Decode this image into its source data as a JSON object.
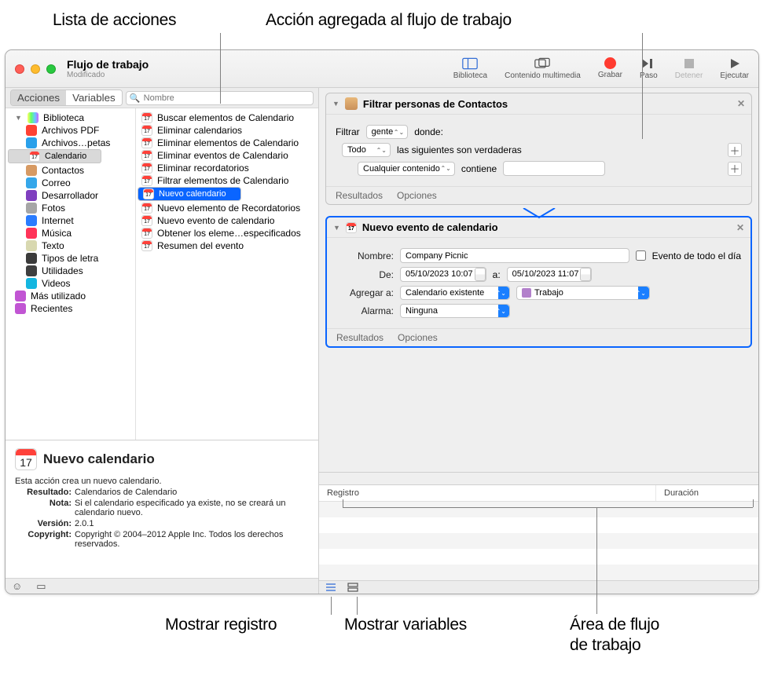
{
  "callouts": {
    "action_list": "Lista de acciones",
    "action_added": "Acción agregada al flujo de trabajo",
    "show_log": "Mostrar registro",
    "show_vars": "Mostrar variables",
    "wf_area_1": "Área de flujo",
    "wf_area_2": "de trabajo"
  },
  "window": {
    "title": "Flujo de trabajo",
    "subtitle": "Modificado"
  },
  "toolbar": {
    "library": "Biblioteca",
    "media": "Contenido multimedia",
    "record": "Grabar",
    "step": "Paso",
    "stop": "Detener",
    "run": "Ejecutar"
  },
  "segbar": {
    "actions": "Acciones",
    "variables": "Variables",
    "search_placeholder": "Nombre"
  },
  "library": {
    "root": "Biblioteca",
    "items": [
      {
        "label": "Archivos PDF",
        "color": "#ff4133"
      },
      {
        "label": "Archivos…petas",
        "color": "#2aa0ea"
      },
      {
        "label": "Calendario",
        "color": "",
        "sel": true,
        "cal": true
      },
      {
        "label": "Contactos",
        "color": "#d79a63"
      },
      {
        "label": "Correo",
        "color": "#35a7ea"
      },
      {
        "label": "Desarrollador",
        "color": "#7f3fbf"
      },
      {
        "label": "Fotos",
        "color": "#a6a6a6"
      },
      {
        "label": "Internet",
        "color": "#2a7cff"
      },
      {
        "label": "Música",
        "color": "#ff3358"
      },
      {
        "label": "Texto",
        "color": "#d8d8b0"
      },
      {
        "label": "Tipos de letra",
        "color": "#3b3b3b"
      },
      {
        "label": "Utilidades",
        "color": "#3f3f3f"
      },
      {
        "label": "Videos",
        "color": "#14b6e0"
      }
    ],
    "extra": [
      {
        "label": "Más utilizado",
        "color": "#c155d3"
      },
      {
        "label": "Recientes",
        "color": "#c155d3"
      }
    ]
  },
  "actions": [
    "Buscar elementos de Calendario",
    "Eliminar calendarios",
    "Eliminar elementos de Calendario",
    "Eliminar eventos de Calendario",
    "Eliminar recordatorios",
    "Filtrar elementos de Calendario",
    "Nuevo calendario",
    "Nuevo elemento de Recordatorios",
    "Nuevo evento de calendario",
    "Obtener los eleme…especificados",
    "Resumen del evento"
  ],
  "actions_sel_index": 6,
  "info": {
    "title": "Nuevo calendario",
    "desc": "Esta acción crea un nuevo calendario.",
    "result_k": "Resultado:",
    "result_v": "Calendarios de Calendario",
    "note_k": "Nota:",
    "note_v": "Si el calendario especificado ya existe, no se creará un calendario nuevo.",
    "ver_k": "Versión:",
    "ver_v": "2.0.1",
    "copy_k": "Copyright:",
    "copy_v": "Copyright © 2004–2012 Apple Inc. Todos los derechos reservados."
  },
  "wf": {
    "filter": {
      "title": "Filtrar personas de Contactos",
      "filter_lbl": "Filtrar",
      "people": "gente",
      "where": "donde:",
      "all": "Todo",
      "following": "las siguientes son verdaderas",
      "anycontent": "Cualquier contenido",
      "contains": "contiene",
      "results": "Resultados",
      "options": "Opciones"
    },
    "event": {
      "title": "Nuevo evento de calendario",
      "name_lbl": "Nombre:",
      "name_val": "Company Picnic",
      "allday": "Evento de todo el día",
      "from_lbl": "De:",
      "from_val": "05/10/2023 10:07",
      "to_lbl": "a:",
      "to_val": "05/10/2023 11:07",
      "addto_lbl": "Agregar a:",
      "addto_val": "Calendario existente",
      "cal_val": "Trabajo",
      "alarm_lbl": "Alarma:",
      "alarm_val": "Ninguna",
      "results": "Resultados",
      "options": "Opciones"
    }
  },
  "log": {
    "col1": "Registro",
    "col2": "Duración"
  }
}
